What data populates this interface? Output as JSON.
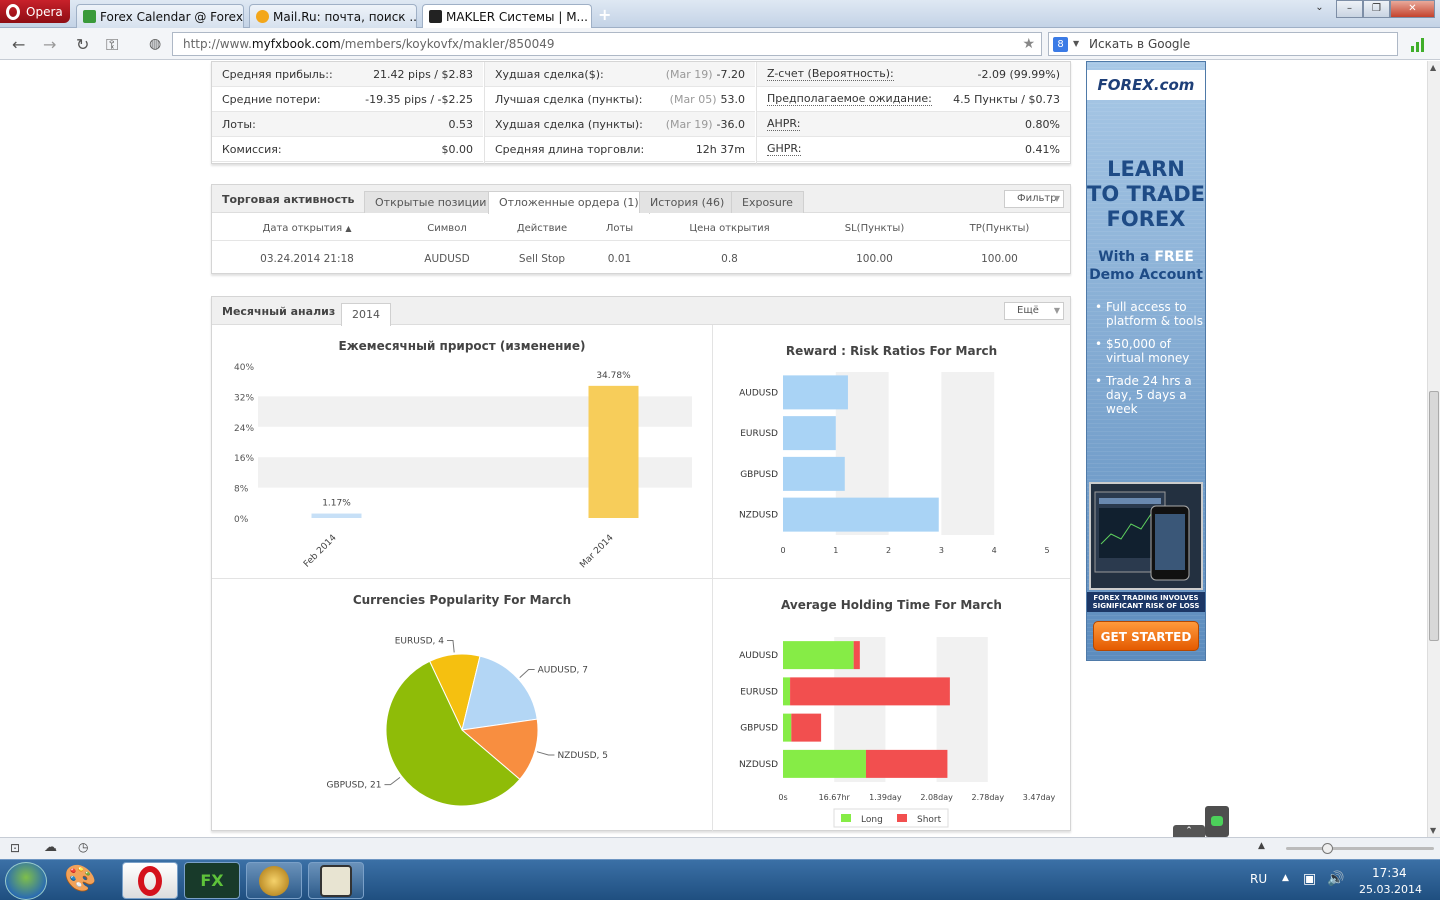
{
  "browser": {
    "menu_label": "Opera",
    "tabs": [
      {
        "label": "Forex Calendar @ Forex..."
      },
      {
        "label": "Mail.Ru: почта, поиск ..."
      },
      {
        "label": "MAKLER Системы | M..."
      }
    ],
    "url_prefix": "http://www.",
    "url_domain": "myfxbook.com",
    "url_path": "/members/koykovfx/makler/850049",
    "search_placeholder": "Искать в Google"
  },
  "stats": {
    "col1": [
      {
        "label": "Средняя прибыль::",
        "value": "21.42 pips / $2.83"
      },
      {
        "label": "Средние потери:",
        "value": "-19.35 pips / -$2.25"
      },
      {
        "label": "Лоты:",
        "value": "0.53"
      },
      {
        "label": "Комиссия:",
        "value": "$0.00"
      }
    ],
    "col2": [
      {
        "label": "Худшая сделка($):",
        "date": "(Mar 19)",
        "value": "-7.20"
      },
      {
        "label": "Лучшая сделка (пункты):",
        "date": "(Mar 05)",
        "value": "53.0"
      },
      {
        "label": "Худшая сделка (пункты):",
        "date": "(Mar 19)",
        "value": "-36.0"
      },
      {
        "label": "Средняя длина торговли:",
        "date": "",
        "value": "12h 37m"
      }
    ],
    "col3": [
      {
        "label": "Z-счет (Вероятность):",
        "value": "-2.09 (99.99%)"
      },
      {
        "label": "Предполагаемое ожидание:",
        "value": "4.5 Пункты / $0.73"
      },
      {
        "label": "AHPR:",
        "value": "0.80%"
      },
      {
        "label": "GHPR:",
        "value": "0.41%"
      }
    ]
  },
  "trading": {
    "title": "Торговая активность",
    "tabs": [
      "Открытые позиции",
      "Отложенные ордера (1)",
      "История (46)",
      "Exposure"
    ],
    "filter_label": "Фильтр",
    "columns": [
      "Дата открытия",
      "Символ",
      "Действие",
      "Лоты",
      "Цена открытия",
      "SL(Пункты)",
      "TP(Пункты)"
    ],
    "rows": [
      [
        "03.24.2014 21:18",
        "AUDUSD",
        "Sell Stop",
        "0.01",
        "0.8",
        "100.00",
        "100.00"
      ]
    ]
  },
  "monthly": {
    "title": "Месячный анализ",
    "year_tab": "2014",
    "more_label": "Ещё"
  },
  "chart_data": [
    {
      "type": "bar",
      "title": "Ежемесячный прирост (изменение)",
      "categories": [
        "Feb 2014",
        "Mar 2014"
      ],
      "values": [
        1.17,
        34.78
      ],
      "value_labels": [
        "1.17%",
        "34.78%"
      ],
      "yticks": [
        "0%",
        "8%",
        "16%",
        "24%",
        "32%",
        "40%"
      ],
      "ylim": [
        0,
        40
      ],
      "colors": [
        "#c7e0f7",
        "#f7cd5a"
      ]
    },
    {
      "type": "bar",
      "title": "Reward : Risk Ratios For March",
      "orientation": "horizontal",
      "categories": [
        "AUDUSD",
        "EURUSD",
        "GBPUSD",
        "NZDUSD"
      ],
      "values": [
        1.23,
        1.0,
        1.17,
        2.95
      ],
      "xticks": [
        "0",
        "1",
        "2",
        "3",
        "4",
        "5"
      ],
      "xlim": [
        0,
        5
      ],
      "color": "#a9d3f5"
    },
    {
      "type": "pie",
      "title": "Currencies Popularity For March",
      "categories": [
        "EURUSD",
        "AUDUSD",
        "NZDUSD",
        "GBPUSD"
      ],
      "labels": [
        "EURUSD, 4",
        "AUDUSD, 7",
        "NZDUSD, 5",
        "GBPUSD, 21"
      ],
      "values": [
        4,
        7,
        5,
        21
      ],
      "colors": [
        "#f5c010",
        "#b3d6f5",
        "#f88e40",
        "#8fbc08"
      ]
    },
    {
      "type": "bar",
      "title": "Average Holding Time For March",
      "orientation": "horizontal",
      "stacked": true,
      "categories": [
        "AUDUSD",
        "EURUSD",
        "GBPUSD",
        "NZDUSD"
      ],
      "xticks": [
        "0s",
        "16.67hr",
        "1.39day",
        "2.08day",
        "2.78day",
        "3.47day"
      ],
      "xlim_hours": [
        0,
        83.3
      ],
      "series": [
        {
          "name": "Long",
          "color": "#86ec46",
          "values_hours": [
            23,
            2.3,
            2.7,
            27
          ]
        },
        {
          "name": "Short",
          "color": "#f24f4f",
          "values_hours": [
            2,
            52,
            9.7,
            26.5
          ]
        }
      ]
    }
  ],
  "ad": {
    "logo": "FOREX.com",
    "headline": [
      "LEARN",
      "TO TRADE",
      "FOREX"
    ],
    "sub1": "With a ",
    "sub1_em": "FREE",
    "sub2": "Demo Account",
    "bullets": [
      "Full access to platform & tools",
      "$50,000 of virtual money",
      "Trade 24 hrs a day, 5 days a week"
    ],
    "risk": "FOREX TRADING INVOLVES SIGNIFICANT RISK OF LOSS",
    "cta": "GET STARTED"
  },
  "system": {
    "lang": "RU",
    "time": "17:34",
    "date": "25.03.2014"
  }
}
